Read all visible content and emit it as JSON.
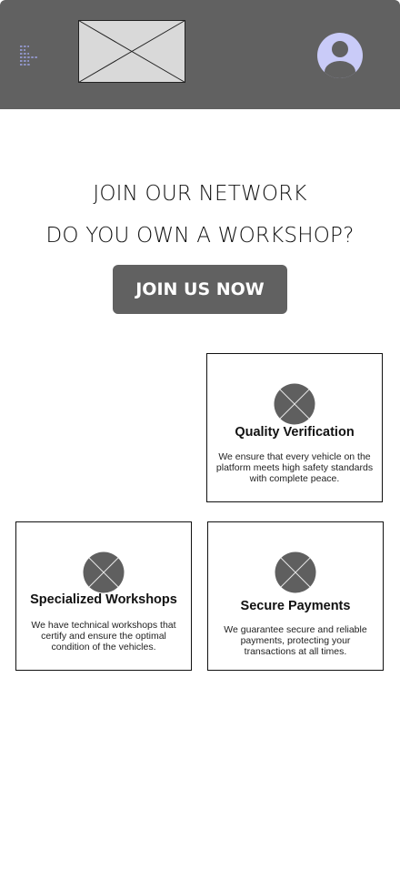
{
  "header": {
    "menu_icon": "hamburger-menu-icon",
    "logo_icon": "image-placeholder-icon",
    "avatar_icon": "user-avatar-icon",
    "background_color": "#616161",
    "avatar_color": "#C9CBF8"
  },
  "hero": {
    "line1": "JOIN OUR NETWORK",
    "line2": "DO YOU OWN A WORKSHOP?",
    "button_label": "JOIN US NOW"
  },
  "features": [
    {
      "icon": "image-placeholder-icon",
      "title": "Quality Verification",
      "description": "We ensure that every vehicle on the platform meets high safety standards with complete peace."
    },
    {
      "icon": "image-placeholder-icon",
      "title": "Specialized Workshops",
      "description": "We have technical workshops that certify and ensure the optimal condition of the vehicles."
    },
    {
      "icon": "image-placeholder-icon",
      "title": "Secure Payments",
      "description": "We guarantee secure and reliable payments, protecting your transactions at all times."
    }
  ]
}
